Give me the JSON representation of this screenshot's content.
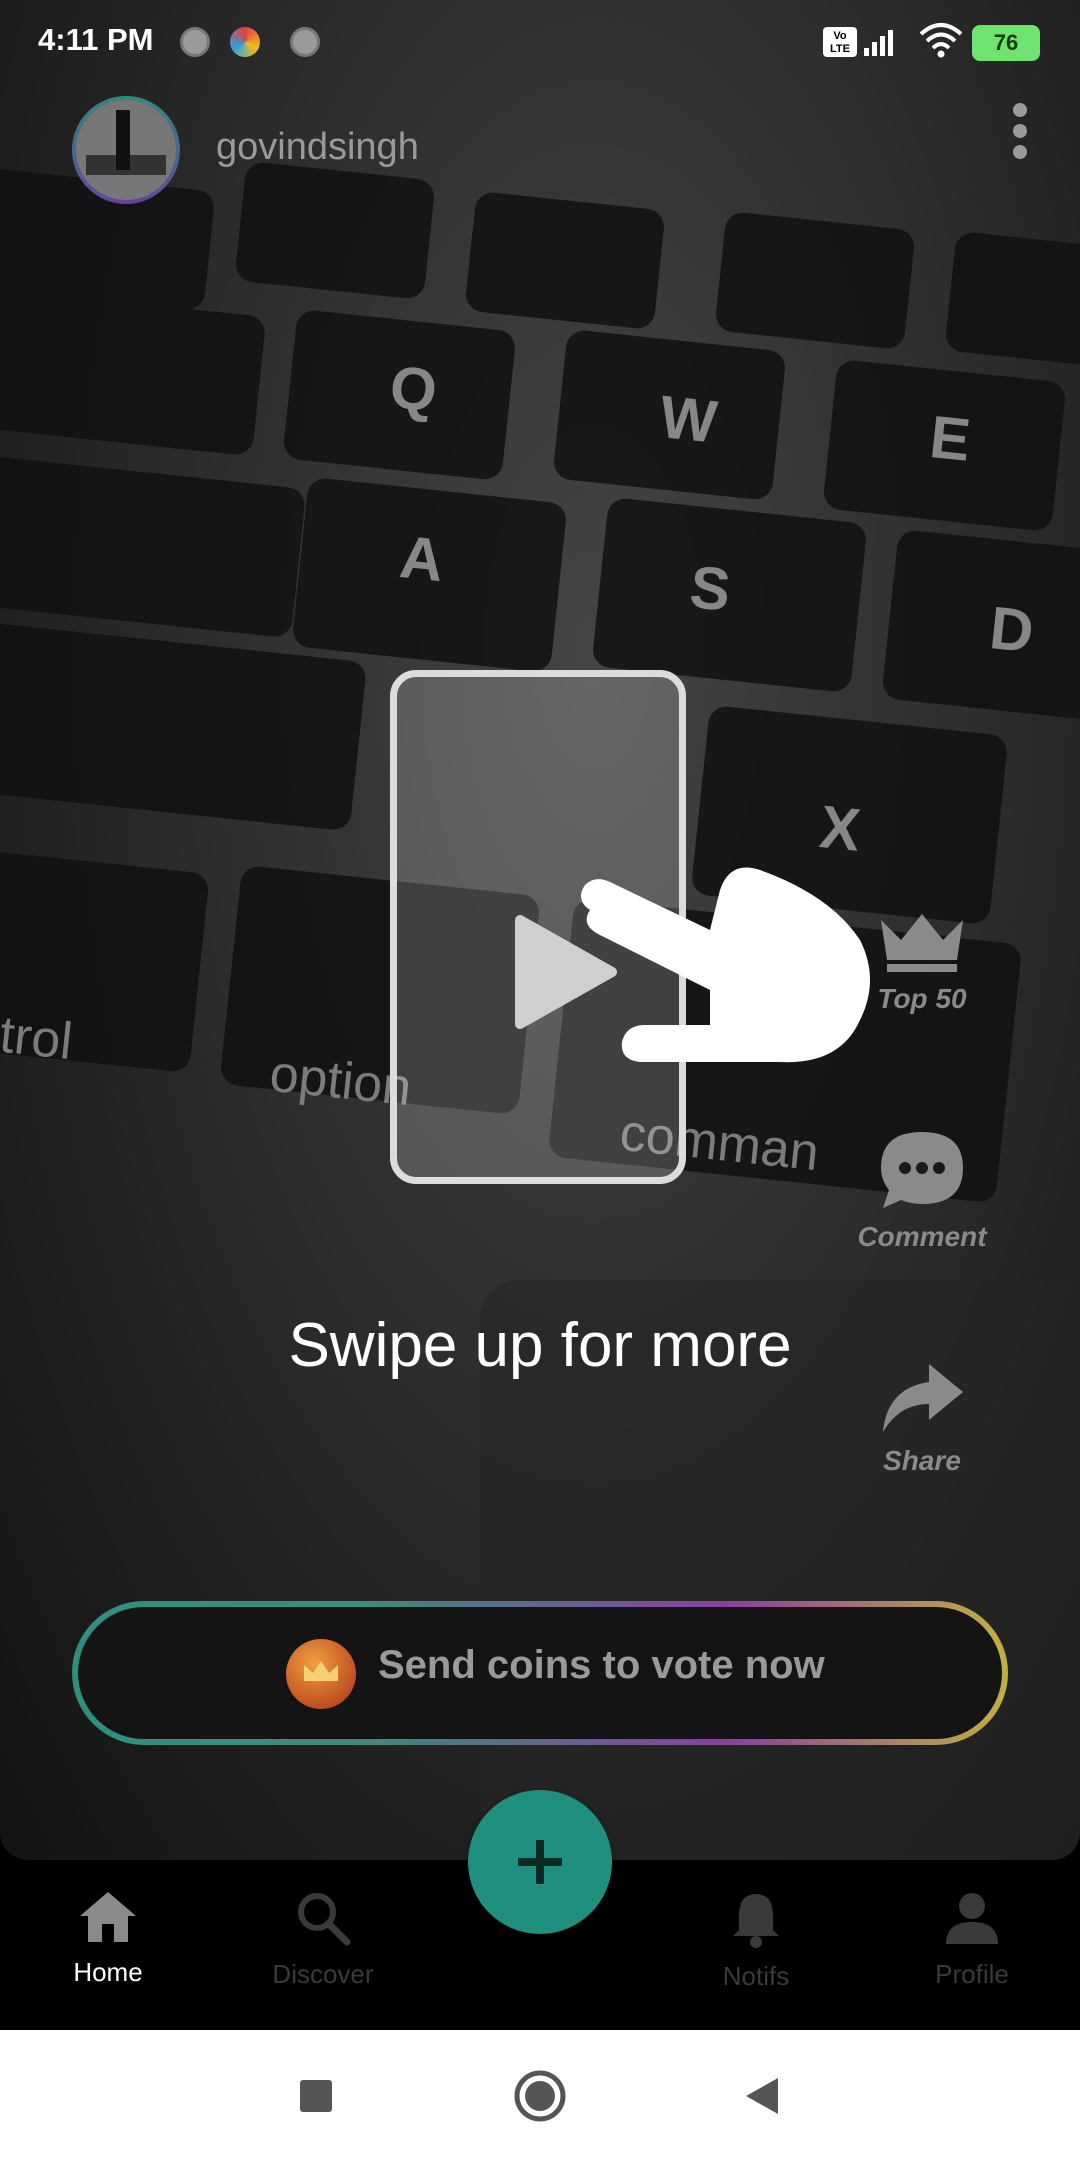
{
  "status_bar": {
    "time": "4:11 PM",
    "battery": "76",
    "icons": [
      "notification-dot-icon",
      "app-icon",
      "notification-dot-icon",
      "volte-icon",
      "signal-icon",
      "wifi-icon",
      "battery-icon"
    ]
  },
  "post": {
    "username": "govindsingh",
    "menu_icon": "more-vert-icon"
  },
  "overlay": {
    "swipe_hint": "Swipe up for more"
  },
  "side_actions": [
    {
      "label": "Top 50",
      "icon": "crown-icon"
    },
    {
      "label": "Comment",
      "icon": "comment-icon"
    },
    {
      "label": "Share",
      "icon": "share-icon"
    }
  ],
  "vote": {
    "label": "Send coins to vote now",
    "gradient_start": "#2e8f7f",
    "gradient_end": "#c0b040"
  },
  "fab": {
    "icon": "plus-icon",
    "color": "#1f8f7e"
  },
  "bottom_nav": [
    {
      "label": "Home",
      "icon": "home-icon",
      "active": true
    },
    {
      "label": "Discover",
      "icon": "search-icon",
      "active": false
    },
    {
      "label": "Notifs",
      "icon": "bell-icon",
      "active": false
    },
    {
      "label": "Profile",
      "icon": "person-icon",
      "active": false
    }
  ],
  "system_nav": [
    "recents-icon",
    "home-circle-icon",
    "back-icon"
  ]
}
